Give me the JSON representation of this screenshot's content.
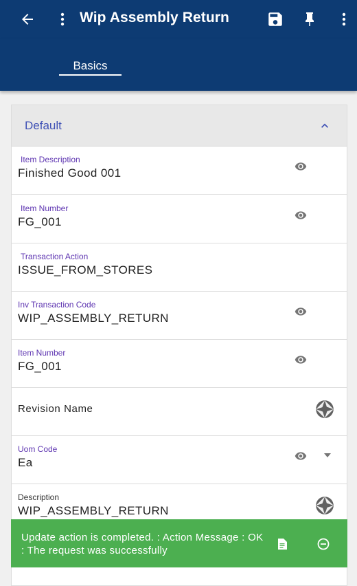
{
  "appbar": {
    "title": "Wip Assembly Return",
    "icons": [
      "back-arrow-icon",
      "more-vert-icon",
      "save-icon",
      "pin-icon",
      "more-vert-icon"
    ]
  },
  "tabs": [
    {
      "label": "Basics",
      "active": true
    }
  ],
  "section": {
    "title": "Default",
    "expanded": true
  },
  "fields": [
    {
      "label": "Item Description",
      "value": "Finished Good 001",
      "icon": "eye-icon"
    },
    {
      "label": "Item Number",
      "value": "FG_001",
      "icon": "eye-icon"
    },
    {
      "label": "Transaction Action",
      "value": "ISSUE_FROM_STORES",
      "icon": ""
    },
    {
      "label": "Inv Transaction Code",
      "value": "WIP_ASSEMBLY_RETURN",
      "icon": "eye-icon"
    },
    {
      "label": "Item Number",
      "value": "FG_001",
      "icon": "eye-icon"
    },
    {
      "label": "Revision Name",
      "value": "",
      "icon": "aperture-icon"
    },
    {
      "label": "Uom Code",
      "value": "Ea",
      "icon": "eye-icon"
    },
    {
      "label": "Description",
      "value": "WIP_ASSEMBLY_RETURN",
      "icon": "aperture-icon"
    }
  ],
  "toast": {
    "message": "Update action is completed.  : Action Message : OK : The request was successfully",
    "color": "#4caf50"
  },
  "colors": {
    "primary": "#0d3b73",
    "accent_label": "#5e35b1",
    "section_title": "#3f51b5"
  }
}
